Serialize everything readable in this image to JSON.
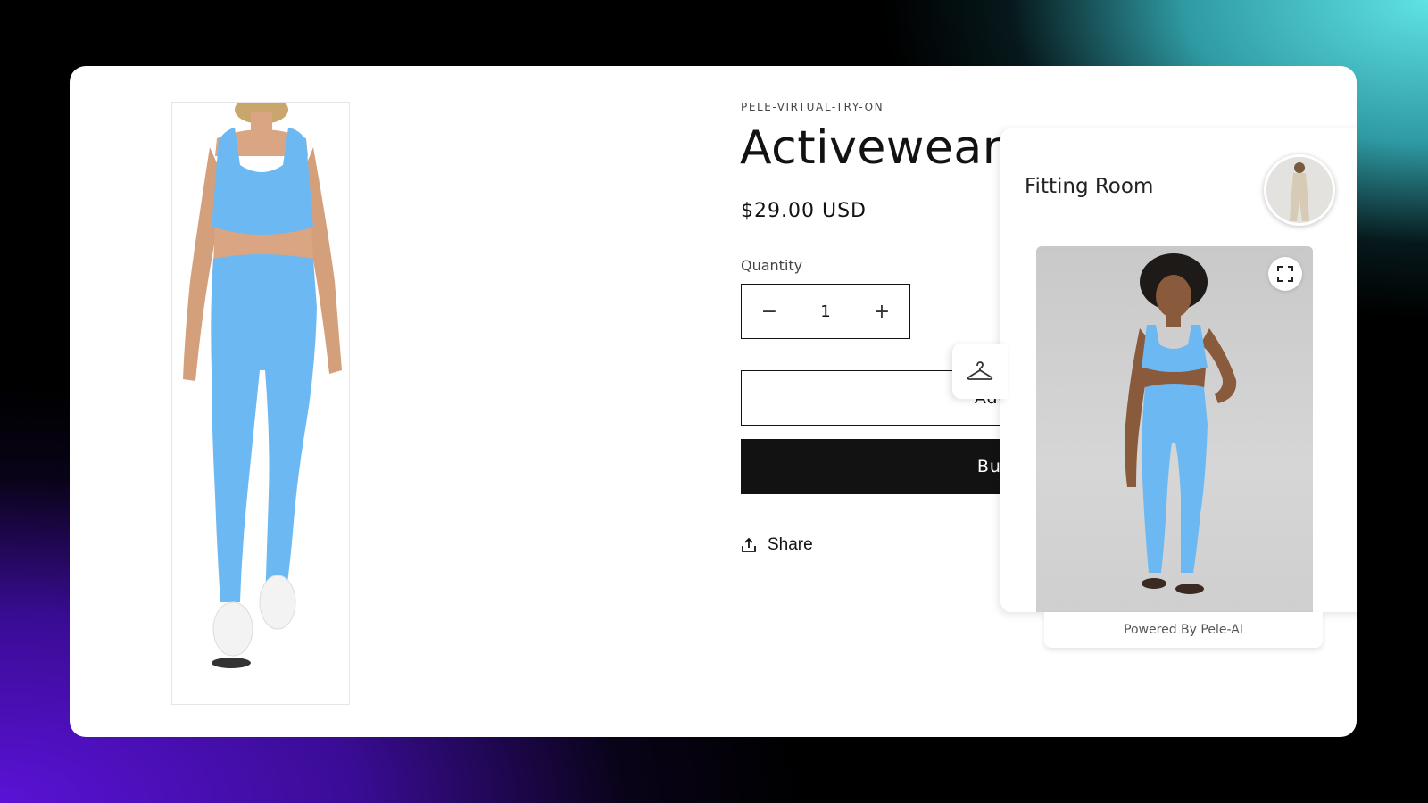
{
  "product": {
    "vendor": "PELE-VIRTUAL-TRY-ON",
    "title": "Activewear S",
    "price": "$29.00 USD",
    "quantity_label": "Quantity",
    "quantity_value": "1",
    "decrement_symbol": "−",
    "increment_symbol": "+",
    "add_to_cart_label": "Add to cart",
    "buy_now_label": "Buy it now",
    "share_label": "Share",
    "main_image_icon": "model-blue-activewear-image"
  },
  "fitting_room": {
    "title": "Fitting Room",
    "avatar_icon": "user-avatar-image",
    "tryon_image_icon": "tryon-result-image",
    "expand_icon": "expand-icon",
    "tab_icon": "hanger-icon",
    "powered_by": "Powered By Pele-AI"
  },
  "colors": {
    "garment_blue": "#6cb8f2",
    "button_dark": "#121212",
    "bg_teal": "#5fe2e3",
    "bg_purple": "#5a12d6"
  }
}
